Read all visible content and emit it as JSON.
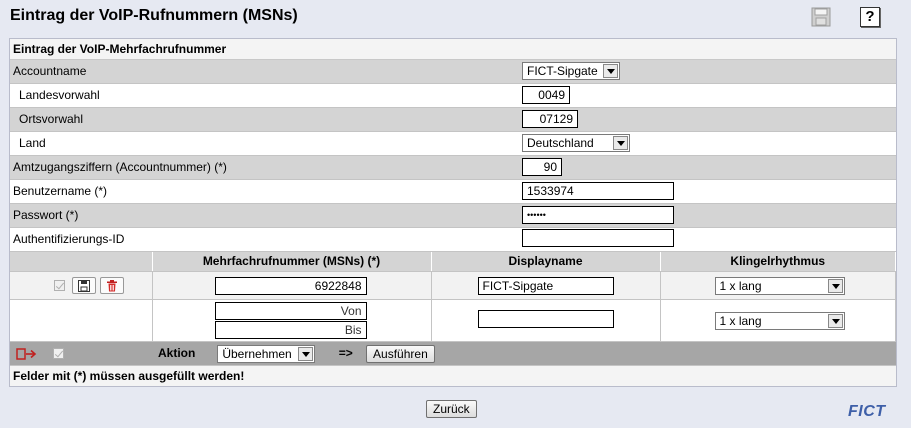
{
  "header": {
    "title": "Eintrag der VoIP-Rufnummern (MSNs)",
    "help_label": "?"
  },
  "section_title": "Eintrag der VoIP-Mehrfachrufnummer",
  "fields": {
    "accountname": {
      "label": "Accountname",
      "value": "FICT-Sipgate"
    },
    "landesvorwahl": {
      "label": "Landesvorwahl",
      "value": "0049"
    },
    "ortsvorwahl": {
      "label": "Ortsvorwahl",
      "value": "07129"
    },
    "land": {
      "label": "Land",
      "value": "Deutschland"
    },
    "amtzugang": {
      "label": "Amtzugangsziffern (Accountnummer) (*)",
      "value": "90"
    },
    "benutzername": {
      "label": "Benutzername (*)",
      "value": "1533974"
    },
    "passwort": {
      "label": "Passwort (*)",
      "value": "••••••"
    },
    "auth_id": {
      "label": "Authentifizierungs-ID",
      "value": ""
    }
  },
  "msn_table": {
    "columns": [
      "Mehrfachrufnummer (MSNs) (*)",
      "Displayname",
      "Klingelrhythmus"
    ],
    "rows": [
      {
        "msn": "6922848",
        "displayname": "FICT-Sipgate",
        "ring": "1 x lang"
      }
    ],
    "new_row": {
      "von_placeholder": "Von",
      "bis_placeholder": "Bis",
      "displayname": "",
      "ring": "1 x lang"
    }
  },
  "action_bar": {
    "label": "Aktion",
    "selected": "Übernehmen",
    "arrow": "=>",
    "execute_label": "Ausführen"
  },
  "footnote": "Felder mit (*) müssen ausgefüllt werden!",
  "back_label": "Zurück",
  "brand": "FICT"
}
